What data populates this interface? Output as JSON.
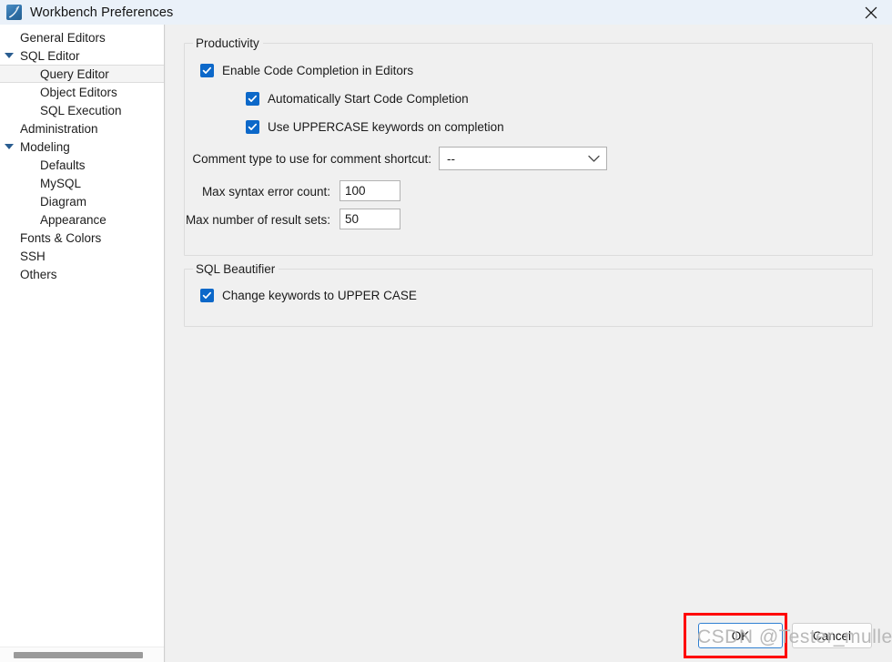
{
  "window": {
    "title": "Workbench Preferences",
    "icon": "mysql-dolphin-icon",
    "close_label": "✕"
  },
  "sidebar": {
    "items": [
      {
        "label": "General Editors",
        "level": 0,
        "arrow": false,
        "selected": false
      },
      {
        "label": "SQL Editor",
        "level": 0,
        "arrow": true,
        "selected": false
      },
      {
        "label": "Query Editor",
        "level": 1,
        "arrow": false,
        "selected": true
      },
      {
        "label": "Object Editors",
        "level": 1,
        "arrow": false,
        "selected": false
      },
      {
        "label": "SQL Execution",
        "level": 1,
        "arrow": false,
        "selected": false
      },
      {
        "label": "Administration",
        "level": 0,
        "arrow": false,
        "selected": false
      },
      {
        "label": "Modeling",
        "level": 0,
        "arrow": true,
        "selected": false
      },
      {
        "label": "Defaults",
        "level": 1,
        "arrow": false,
        "selected": false
      },
      {
        "label": "MySQL",
        "level": 1,
        "arrow": false,
        "selected": false
      },
      {
        "label": "Diagram",
        "level": 1,
        "arrow": false,
        "selected": false
      },
      {
        "label": "Appearance",
        "level": 1,
        "arrow": false,
        "selected": false
      },
      {
        "label": "Fonts & Colors",
        "level": 0,
        "arrow": false,
        "selected": false
      },
      {
        "label": "SSH",
        "level": 0,
        "arrow": false,
        "selected": false
      },
      {
        "label": "Others",
        "level": 0,
        "arrow": false,
        "selected": false
      }
    ]
  },
  "productivity": {
    "legend": "Productivity",
    "checkbox_enable_completion": {
      "label": "Enable Code Completion in Editors",
      "checked": true
    },
    "checkbox_auto_start": {
      "label": "Automatically Start Code Completion",
      "checked": true
    },
    "checkbox_uppercase": {
      "label": "Use UPPERCASE keywords on completion",
      "checked": true
    },
    "comment_type_label": "Comment type to use for comment shortcut:",
    "comment_type_value": "--",
    "max_syntax_error_label": "Max syntax error count:",
    "max_syntax_error_value": "100",
    "max_result_sets_label": "Max number of result sets:",
    "max_result_sets_value": "50"
  },
  "beautifier": {
    "legend": "SQL Beautifier",
    "checkbox_upper_case": {
      "label": "Change keywords to UPPER CASE",
      "checked": true
    }
  },
  "footer": {
    "ok_label": "OK",
    "cancel_label": "Cancel"
  },
  "watermark": {
    "text": "CSDN @Tester_muller"
  },
  "background": {
    "fragments": [
      "S",
      "S",
      "C"
    ]
  },
  "colors": {
    "titlebar": "#eaf1f9",
    "checkbox_blue": "#0c68c9",
    "accent_focus": "#2f7fd1",
    "highlight_red": "#ff0000",
    "selection_row": "#f4f4f4"
  }
}
